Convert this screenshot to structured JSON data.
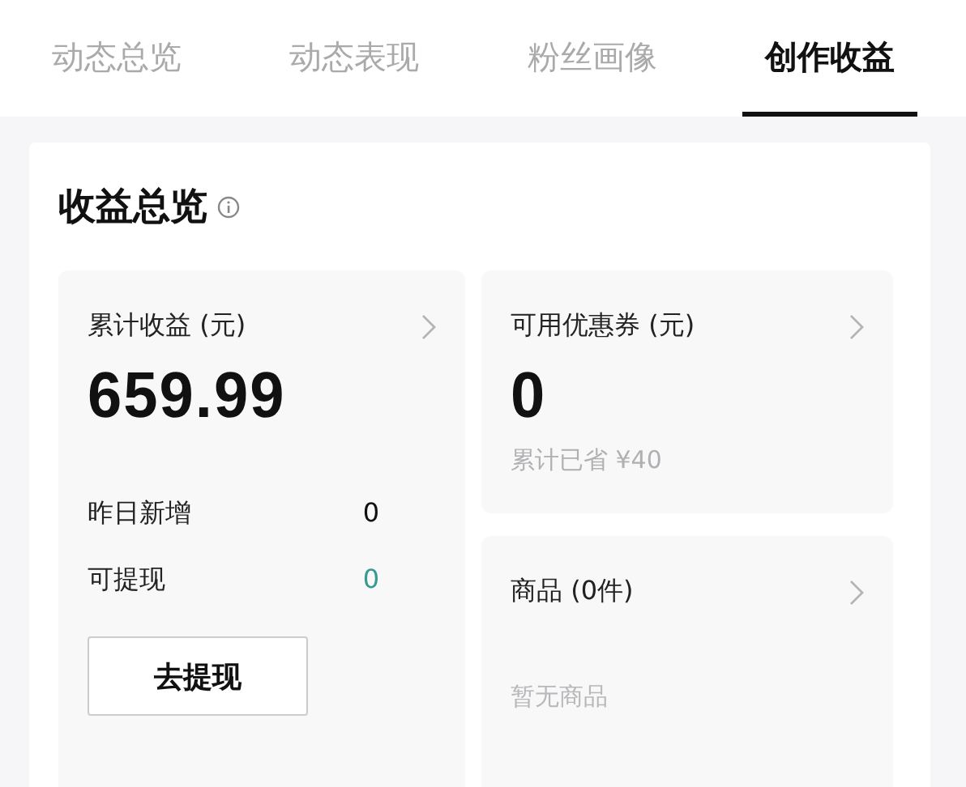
{
  "tabs": [
    {
      "label": "动态总览",
      "selected": false
    },
    {
      "label": "动态表现",
      "selected": false
    },
    {
      "label": "粉丝画像",
      "selected": false
    },
    {
      "label": "创作收益",
      "selected": true
    }
  ],
  "overview": {
    "title": "收益总览"
  },
  "earnings": {
    "label": "累计收益 (元)",
    "value": "659.99",
    "rows": [
      {
        "label": "昨日新增",
        "value": "0",
        "kind": "plain"
      },
      {
        "label": "可提现",
        "value": "0",
        "kind": "highlight"
      }
    ],
    "button": "去提现"
  },
  "coupons": {
    "label": "可用优惠券 (元)",
    "value": "0",
    "note": "累计已省 ¥40"
  },
  "products": {
    "label": "商品 (0件)",
    "empty": "暂无商品"
  }
}
